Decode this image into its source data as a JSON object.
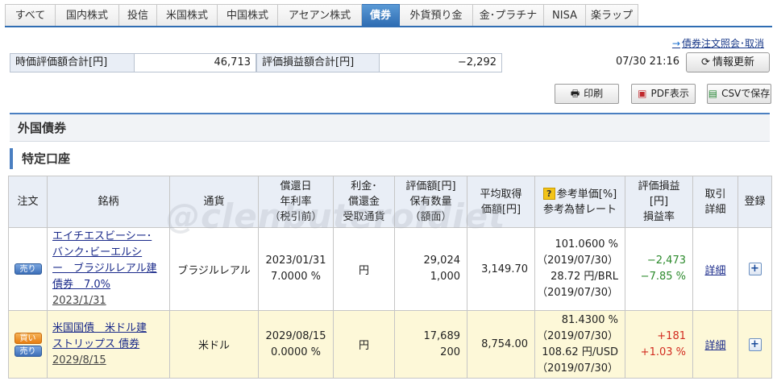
{
  "tabs": [
    "すべて",
    "国内株式",
    "投信",
    "米国株式",
    "中国株式",
    "アセアン株式",
    "債券",
    "外貨預り金",
    "金･プラチナ",
    "NISA",
    "楽ラップ"
  ],
  "active_tab": "債券",
  "order_link": "債券注文照会･取消",
  "summary": {
    "market_value_label": "時価評価額合計[円]",
    "market_value": "46,713",
    "pl_label": "評価損益額合計[円]",
    "pl_value": "−2,292"
  },
  "timestamp": "07/30 21:16",
  "buttons": {
    "refresh": "情報更新",
    "print": "印刷",
    "pdf": "PDF表示",
    "csv": "CSVで保存"
  },
  "section_title": "外国債券",
  "account_title": "特定口座",
  "table": {
    "headers": {
      "order": "注文",
      "name": "銘柄",
      "currency": "通貨",
      "redemption": [
        "償還日",
        "年利率",
        "（税引前）"
      ],
      "interest": [
        "利金･",
        "償還金",
        "受取通貨"
      ],
      "valuation": [
        "評価額[円]",
        "保有数量",
        "（額面）"
      ],
      "avg_price": [
        "平均取得",
        "価額[円]"
      ],
      "ref_price": [
        "参考単価[%]",
        "参考為替レート"
      ],
      "pl": [
        "評価損益",
        "[円]",
        "損益率"
      ],
      "trade": [
        "取引",
        "詳細"
      ],
      "register": "登録"
    },
    "rows": [
      {
        "order_buttons": [
          "売り"
        ],
        "name_lines": [
          "エイチエスビーシー･",
          "バンク･ビーエルシ",
          "ー　ブラジルレアル建",
          "債券　7.0%"
        ],
        "name_date": "2023/1/31",
        "currency": "ブラジルレアル",
        "redemption_date": "2023/01/31",
        "rate": "7.0000 %",
        "interest_currency": "円",
        "valuation": "29,024",
        "quantity": "1,000",
        "avg_price": "3,149.70",
        "ref_price": "101.0600 %",
        "ref_price_date": "（2019/07/30）",
        "fx_rate": "28.72 円/BRL",
        "fx_date": "（2019/07/30）",
        "pl": "−2,473",
        "pl_rate": "−7.85 %",
        "detail": "詳細"
      },
      {
        "order_buttons": [
          "買い",
          "売り"
        ],
        "name_lines": [
          "米国国債　米ドル建",
          "ストリップス 債券"
        ],
        "name_date": "2029/8/15",
        "currency": "米ドル",
        "redemption_date": "2029/08/15",
        "rate": "0.0000 %",
        "interest_currency": "円",
        "valuation": "17,689",
        "quantity": "200",
        "avg_price": "8,754.00",
        "ref_price": "81.4300 %",
        "ref_price_date": "（2019/07/30）",
        "fx_rate": "108.62 円/USD",
        "fx_date": "（2019/07/30）",
        "pl": "+181",
        "pl_rate": "+1.03 %",
        "detail": "詳細"
      }
    ]
  },
  "watermark": "@clenbuteroldiet",
  "colors": {
    "accent": "#2f6db3",
    "header_bg": "#e9eef6",
    "row_highlight": "#fdf8d8",
    "positive": "#d22b1f",
    "negative": "#2c8a2c"
  },
  "icons": {
    "refresh": "refresh-icon",
    "print": "printer-icon",
    "pdf": "pdf-icon",
    "csv": "csv-icon",
    "hint": "question-icon",
    "register": "plus-icon"
  }
}
